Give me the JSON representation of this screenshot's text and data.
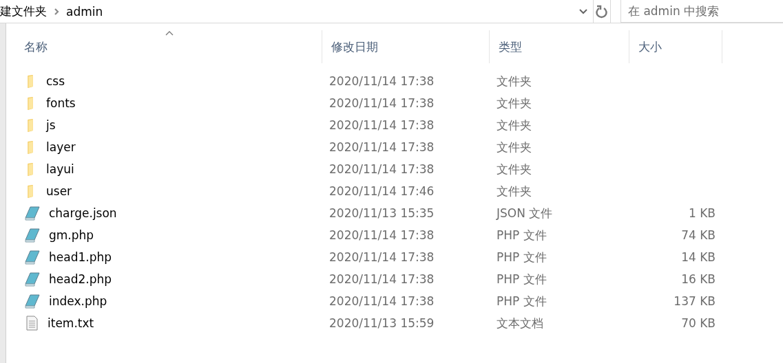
{
  "address_bar": {
    "path": [
      {
        "label": "建文件夹"
      },
      {
        "label": "admin"
      }
    ]
  },
  "search": {
    "placeholder": "在 admin 中搜索"
  },
  "columns": [
    {
      "label": "名称",
      "sorted": true
    },
    {
      "label": "修改日期",
      "sorted": false
    },
    {
      "label": "类型",
      "sorted": false
    },
    {
      "label": "大小",
      "sorted": false
    }
  ],
  "files": [
    {
      "kind": "folder",
      "name": "css",
      "date": "2020/11/14 17:38",
      "type": "文件夹"
    },
    {
      "kind": "folder",
      "name": "fonts",
      "date": "2020/11/14 17:38",
      "type": "文件夹"
    },
    {
      "kind": "folder",
      "name": "js",
      "date": "2020/11/14 17:38",
      "type": "文件夹"
    },
    {
      "kind": "folder",
      "name": "layer",
      "date": "2020/11/14 17:38",
      "type": "文件夹"
    },
    {
      "kind": "folder",
      "name": "layui",
      "date": "2020/11/14 17:38",
      "type": "文件夹"
    },
    {
      "kind": "folder",
      "name": "user",
      "date": "2020/11/14 17:46",
      "type": "文件夹"
    },
    {
      "kind": "script",
      "name": "charge.json",
      "date": "2020/11/13 15:35",
      "type": "JSON 文件",
      "size": "1 KB"
    },
    {
      "kind": "script",
      "name": "gm.php",
      "date": "2020/11/14 17:38",
      "type": "PHP 文件",
      "size": "74 KB"
    },
    {
      "kind": "script",
      "name": "head1.php",
      "date": "2020/11/14 17:38",
      "type": "PHP 文件",
      "size": "14 KB"
    },
    {
      "kind": "script",
      "name": "head2.php",
      "date": "2020/11/14 17:38",
      "type": "PHP 文件",
      "size": "16 KB"
    },
    {
      "kind": "script",
      "name": "index.php",
      "date": "2020/11/14 17:38",
      "type": "PHP 文件",
      "size": "137 KB"
    },
    {
      "kind": "text",
      "name": "item.txt",
      "date": "2020/11/13 15:59",
      "type": "文本文档",
      "size": "70 KB"
    }
  ]
}
